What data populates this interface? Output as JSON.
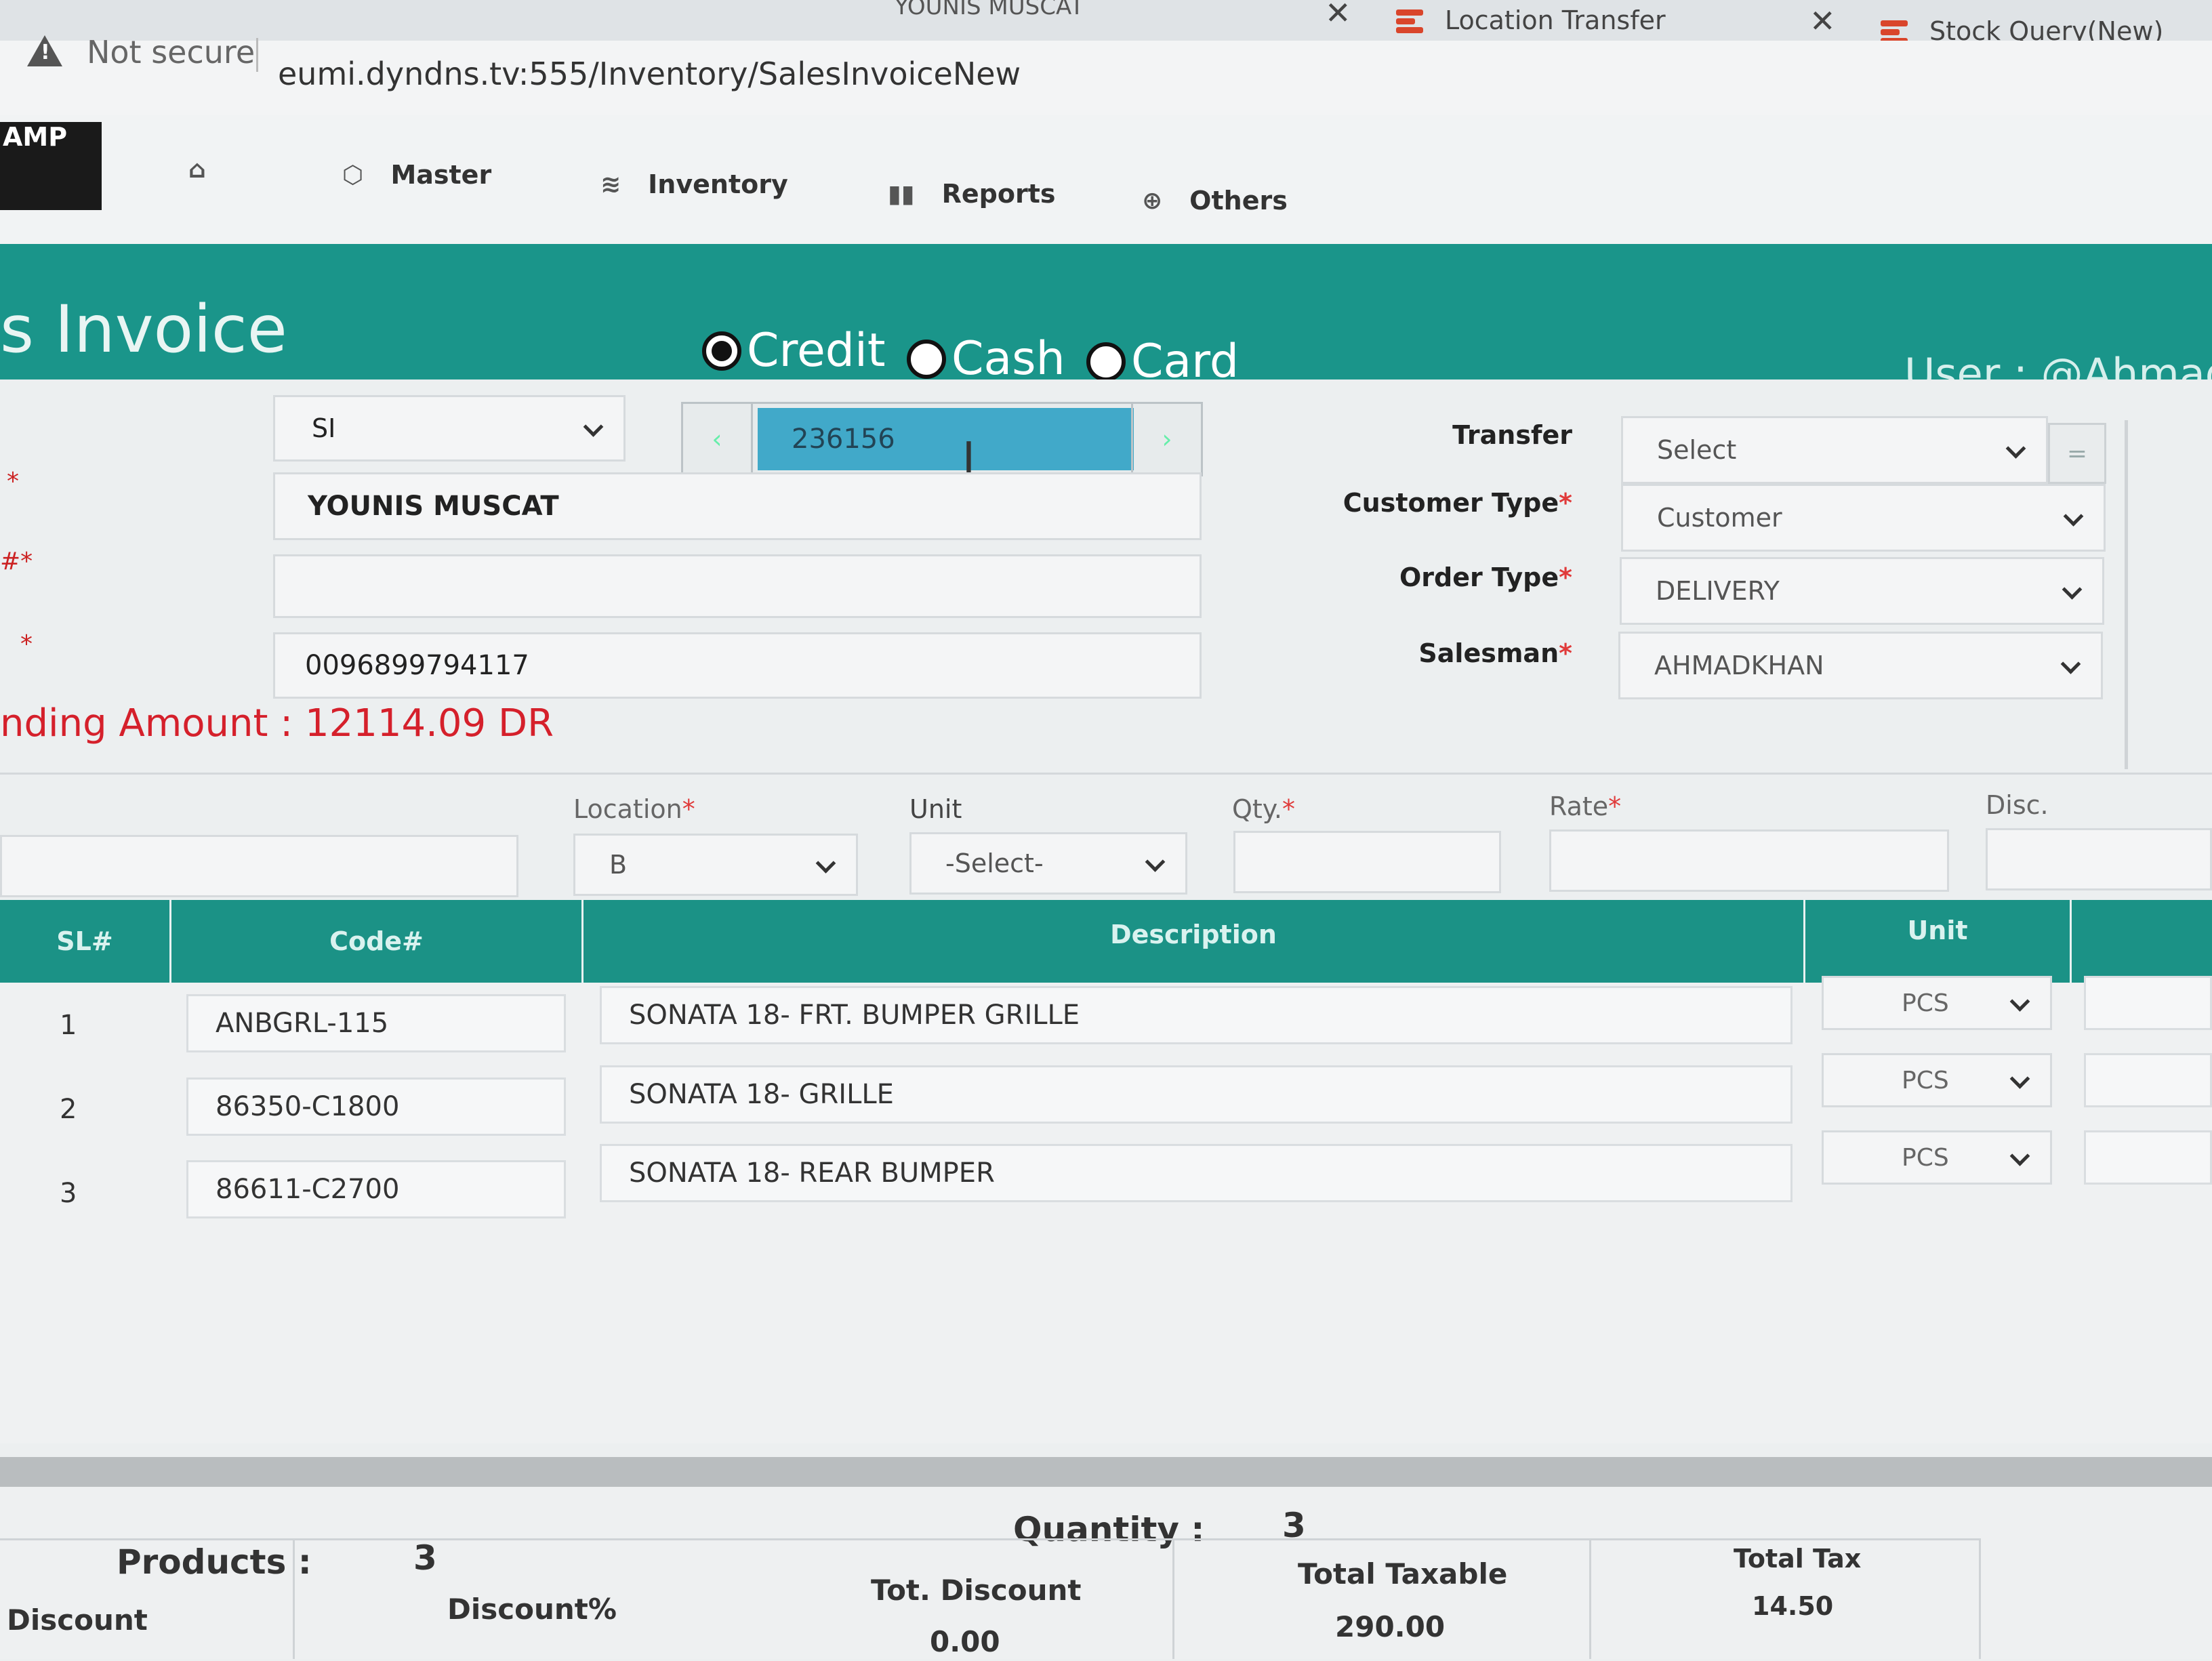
{
  "browser": {
    "tabs": [
      {
        "label": "YOUNIS MUSCAT"
      },
      {
        "label": "Location Transfer"
      },
      {
        "label": "Stock Query(New)"
      }
    ],
    "security_label": "Not secure",
    "url": "eumi.dyndns.tv:555/Inventory/SalesInvoiceNew"
  },
  "app": {
    "brand": "AMP",
    "nav": [
      {
        "label": "Master",
        "icon": "cube-icon"
      },
      {
        "label": "Inventory",
        "icon": "layers-icon"
      },
      {
        "label": "Reports",
        "icon": "bar-chart-icon"
      },
      {
        "label": "Others",
        "icon": "globe-icon"
      }
    ]
  },
  "header": {
    "title": "s Invoice",
    "payment_modes": [
      {
        "label": "Credit",
        "selected": true
      },
      {
        "label": "Cash",
        "selected": false
      },
      {
        "label": "Card",
        "selected": false
      }
    ],
    "user": "User : @Ahmadk"
  },
  "form": {
    "doc_type": "SI",
    "doc_number": "236156",
    "customer_name": "YOUNIS MUSCAT",
    "ref_number": "",
    "phone": "0096899794117",
    "pending_amount": "nding Amount : 12114.09 DR",
    "right": {
      "transfer_label": "Transfer",
      "transfer_value": "Select",
      "customer_type_label": "Customer Type",
      "customer_type_value": "Customer",
      "order_type_label": "Order Type",
      "order_type_value": "DELIVERY",
      "salesman_label": "Salesman",
      "salesman_value": "AHMADKHAN",
      "required_mark": "*"
    }
  },
  "entry": {
    "location_label": "Location",
    "location_value": "B",
    "unit_label": "Unit",
    "unit_value": "-Select-",
    "qty_label": "Qty.",
    "rate_label": "Rate",
    "disc_label": "Disc."
  },
  "table": {
    "headers": [
      "SL#",
      "Code#",
      "Description",
      "Unit"
    ],
    "rows": [
      {
        "sl": "1",
        "code": "ANBGRL-115",
        "description": "SONATA 18- FRT. BUMPER GRILLE",
        "unit": "PCS"
      },
      {
        "sl": "2",
        "code": "86350-C1800",
        "description": "SONATA 18- GRILLE",
        "unit": "PCS"
      },
      {
        "sl": "3",
        "code": "86611-C2700",
        "description": "SONATA 18- REAR BUMPER",
        "unit": "PCS"
      }
    ]
  },
  "totals": {
    "products_label": "Products :",
    "products_value": "3",
    "quantity_label": "Quantity :",
    "quantity_value": "3",
    "discount_label": "Discount",
    "discount_pct_label": "Discount%",
    "tot_discount_label": "Tot. Discount",
    "tot_discount_value": "0.00",
    "total_taxable_label": "Total Taxable",
    "total_taxable_value": "290.00",
    "total_tax_label": "Total Tax",
    "total_tax_value": "14.50"
  },
  "colors": {
    "teal": "#1a958a",
    "pending_red": "#d5202b",
    "highlight_blue": "#41a9c9"
  }
}
